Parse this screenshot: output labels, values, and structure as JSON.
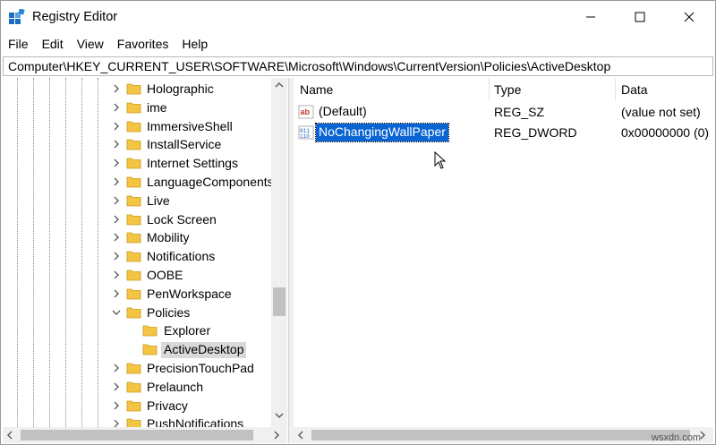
{
  "window": {
    "title": "Registry Editor"
  },
  "menu": [
    "File",
    "Edit",
    "View",
    "Favorites",
    "Help"
  ],
  "address": "Computer\\HKEY_CURRENT_USER\\SOFTWARE\\Microsoft\\Windows\\CurrentVersion\\Policies\\ActiveDesktop",
  "tree": {
    "items": [
      {
        "label": "Holographic",
        "expander": "collapsed"
      },
      {
        "label": "ime",
        "expander": "collapsed"
      },
      {
        "label": "ImmersiveShell",
        "expander": "collapsed"
      },
      {
        "label": "InstallService",
        "expander": "collapsed"
      },
      {
        "label": "Internet Settings",
        "expander": "collapsed"
      },
      {
        "label": "LanguageComponents",
        "expander": "collapsed"
      },
      {
        "label": "Live",
        "expander": "collapsed"
      },
      {
        "label": "Lock Screen",
        "expander": "collapsed"
      },
      {
        "label": "Mobility",
        "expander": "collapsed"
      },
      {
        "label": "Notifications",
        "expander": "collapsed"
      },
      {
        "label": "OOBE",
        "expander": "collapsed"
      },
      {
        "label": "PenWorkspace",
        "expander": "collapsed"
      },
      {
        "label": "Policies",
        "expander": "expanded"
      },
      {
        "label": "Explorer",
        "expander": "none"
      },
      {
        "label": "ActiveDesktop",
        "expander": "none",
        "selected": true
      },
      {
        "label": "PrecisionTouchPad",
        "expander": "collapsed"
      },
      {
        "label": "Prelaunch",
        "expander": "collapsed"
      },
      {
        "label": "Privacy",
        "expander": "collapsed"
      },
      {
        "label": "PushNotifications",
        "expander": "collapsed"
      }
    ]
  },
  "values": {
    "headers": {
      "name": "Name",
      "type": "Type",
      "data": "Data"
    },
    "rows": [
      {
        "icon": "string-value-icon",
        "name": "(Default)",
        "type": "REG_SZ",
        "data": "(value not set)"
      },
      {
        "icon": "dword-value-icon",
        "name": "NoChangingWallPaper",
        "type": "REG_DWORD",
        "data": "0x00000000 (0)",
        "selected": true
      }
    ]
  },
  "watermark": "wsxdn.com",
  "colors": {
    "selection": "#0a64d2",
    "tree_selection": "#d9d9d9",
    "folder": "#f4c542"
  }
}
